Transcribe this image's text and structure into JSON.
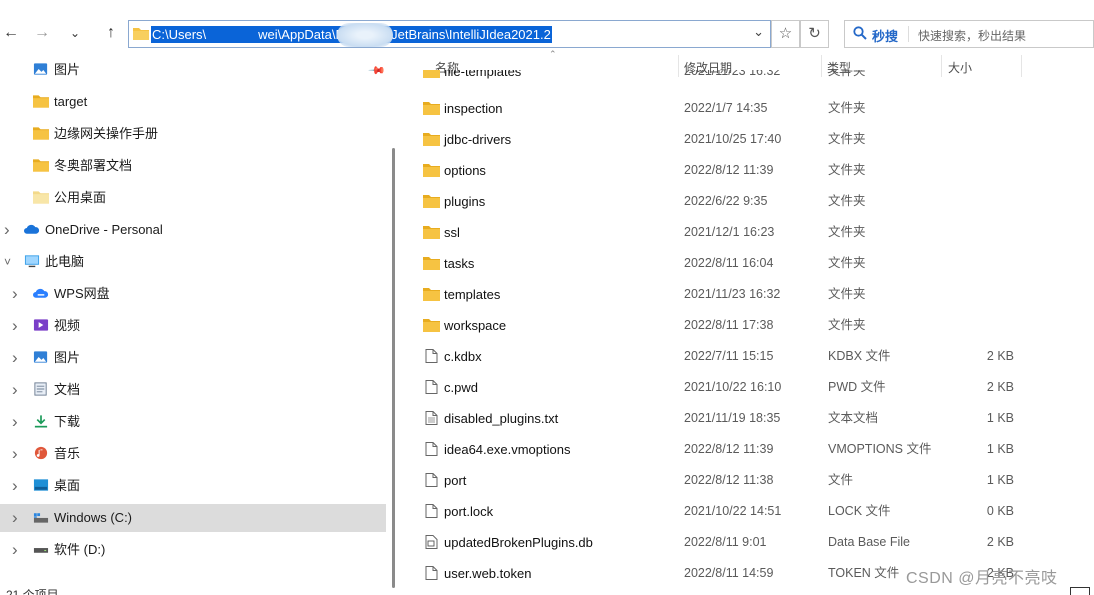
{
  "toolbar": {
    "back_icon": "arrow-left",
    "forward_icon": "arrow-right",
    "history_icon": "chevron-down",
    "up_icon": "arrow-up",
    "address_path": "C:\\Users\\    wei\\AppData\\Roaming\\JetBrains\\IntelliJIdea2021.2",
    "favorite_icon": "star",
    "refresh_icon": "refresh",
    "search_brand": "秒搜",
    "search_placeholder": "快速搜索，秒出结果"
  },
  "sidebar": {
    "items": [
      {
        "label": "图片",
        "icon": "pictures-icon",
        "indent": 1,
        "expandable": false
      },
      {
        "label": "target",
        "icon": "folder-icon",
        "indent": 1,
        "expandable": false
      },
      {
        "label": "边缘网关操作手册",
        "icon": "folder-icon",
        "indent": 1,
        "expandable": false
      },
      {
        "label": "冬奥部署文档",
        "icon": "folder-icon",
        "indent": 1,
        "expandable": false
      },
      {
        "label": "公用桌面",
        "icon": "folder-light-icon",
        "indent": 1,
        "expandable": false
      },
      {
        "label": "OneDrive - Personal",
        "icon": "cloud-icon",
        "indent": 0,
        "expandable": true,
        "expanded": false
      },
      {
        "label": "此电脑",
        "icon": "computer-icon",
        "indent": 0,
        "expandable": true,
        "expanded": true
      },
      {
        "label": "WPS网盘",
        "icon": "wps-cloud-icon",
        "indent": 1,
        "expandable": true
      },
      {
        "label": "视频",
        "icon": "video-icon",
        "indent": 1,
        "expandable": true
      },
      {
        "label": "图片",
        "icon": "pictures-icon",
        "indent": 1,
        "expandable": true
      },
      {
        "label": "文档",
        "icon": "documents-icon",
        "indent": 1,
        "expandable": true
      },
      {
        "label": "下载",
        "icon": "download-icon",
        "indent": 1,
        "expandable": true
      },
      {
        "label": "音乐",
        "icon": "music-icon",
        "indent": 1,
        "expandable": true
      },
      {
        "label": "桌面",
        "icon": "desktop-icon",
        "indent": 1,
        "expandable": true
      },
      {
        "label": "Windows (C:)",
        "icon": "drive-c-icon",
        "indent": 1,
        "expandable": true,
        "selected": true
      },
      {
        "label": "软件 (D:)",
        "icon": "drive-icon",
        "indent": 1,
        "expandable": true
      }
    ],
    "bottom_cut": "21 个项目"
  },
  "columns": {
    "name": "名称",
    "date": "修改日期",
    "type": "类型",
    "size": "大小"
  },
  "partial_row": {
    "name": "file-templates",
    "date": "2021/11/23 16:32",
    "type": "文件夹"
  },
  "files": [
    {
      "name": "inspection",
      "date": "2022/1/7 14:35",
      "type": "文件夹",
      "size": "",
      "icon": "folder-icon"
    },
    {
      "name": "jdbc-drivers",
      "date": "2021/10/25 17:40",
      "type": "文件夹",
      "size": "",
      "icon": "folder-icon"
    },
    {
      "name": "options",
      "date": "2022/8/12 11:39",
      "type": "文件夹",
      "size": "",
      "icon": "folder-icon"
    },
    {
      "name": "plugins",
      "date": "2022/6/22 9:35",
      "type": "文件夹",
      "size": "",
      "icon": "folder-icon"
    },
    {
      "name": "ssl",
      "date": "2021/12/1 16:23",
      "type": "文件夹",
      "size": "",
      "icon": "folder-icon"
    },
    {
      "name": "tasks",
      "date": "2022/8/11 16:04",
      "type": "文件夹",
      "size": "",
      "icon": "folder-icon"
    },
    {
      "name": "templates",
      "date": "2021/11/23 16:32",
      "type": "文件夹",
      "size": "",
      "icon": "folder-icon"
    },
    {
      "name": "workspace",
      "date": "2022/8/11 17:38",
      "type": "文件夹",
      "size": "",
      "icon": "folder-icon"
    },
    {
      "name": "c.kdbx",
      "date": "2022/7/11 15:15",
      "type": "KDBX 文件",
      "size": "2 KB",
      "icon": "file-icon"
    },
    {
      "name": "c.pwd",
      "date": "2021/10/22 16:10",
      "type": "PWD 文件",
      "size": "2 KB",
      "icon": "file-icon"
    },
    {
      "name": "disabled_plugins.txt",
      "date": "2021/11/19 18:35",
      "type": "文本文档",
      "size": "1 KB",
      "icon": "text-file-icon"
    },
    {
      "name": "idea64.exe.vmoptions",
      "date": "2022/8/12 11:39",
      "type": "VMOPTIONS 文件",
      "size": "1 KB",
      "icon": "file-icon"
    },
    {
      "name": "port",
      "date": "2022/8/12 11:38",
      "type": "文件",
      "size": "1 KB",
      "icon": "file-icon"
    },
    {
      "name": "port.lock",
      "date": "2021/10/22 14:51",
      "type": "LOCK 文件",
      "size": "0 KB",
      "icon": "file-icon"
    },
    {
      "name": "updatedBrokenPlugins.db",
      "date": "2022/8/11 9:01",
      "type": "Data Base File",
      "size": "2 KB",
      "icon": "db-file-icon"
    },
    {
      "name": "user.web.token",
      "date": "2022/8/11 14:59",
      "type": "TOKEN 文件",
      "size": "2 KB",
      "icon": "file-icon"
    }
  ],
  "watermark": "CSDN @月亮不亮吱",
  "colors": {
    "selection": "#0a64d8",
    "folder": "#f6c342",
    "sidebar_selected": "#dcdcdc",
    "search_brand": "#2468c8"
  }
}
